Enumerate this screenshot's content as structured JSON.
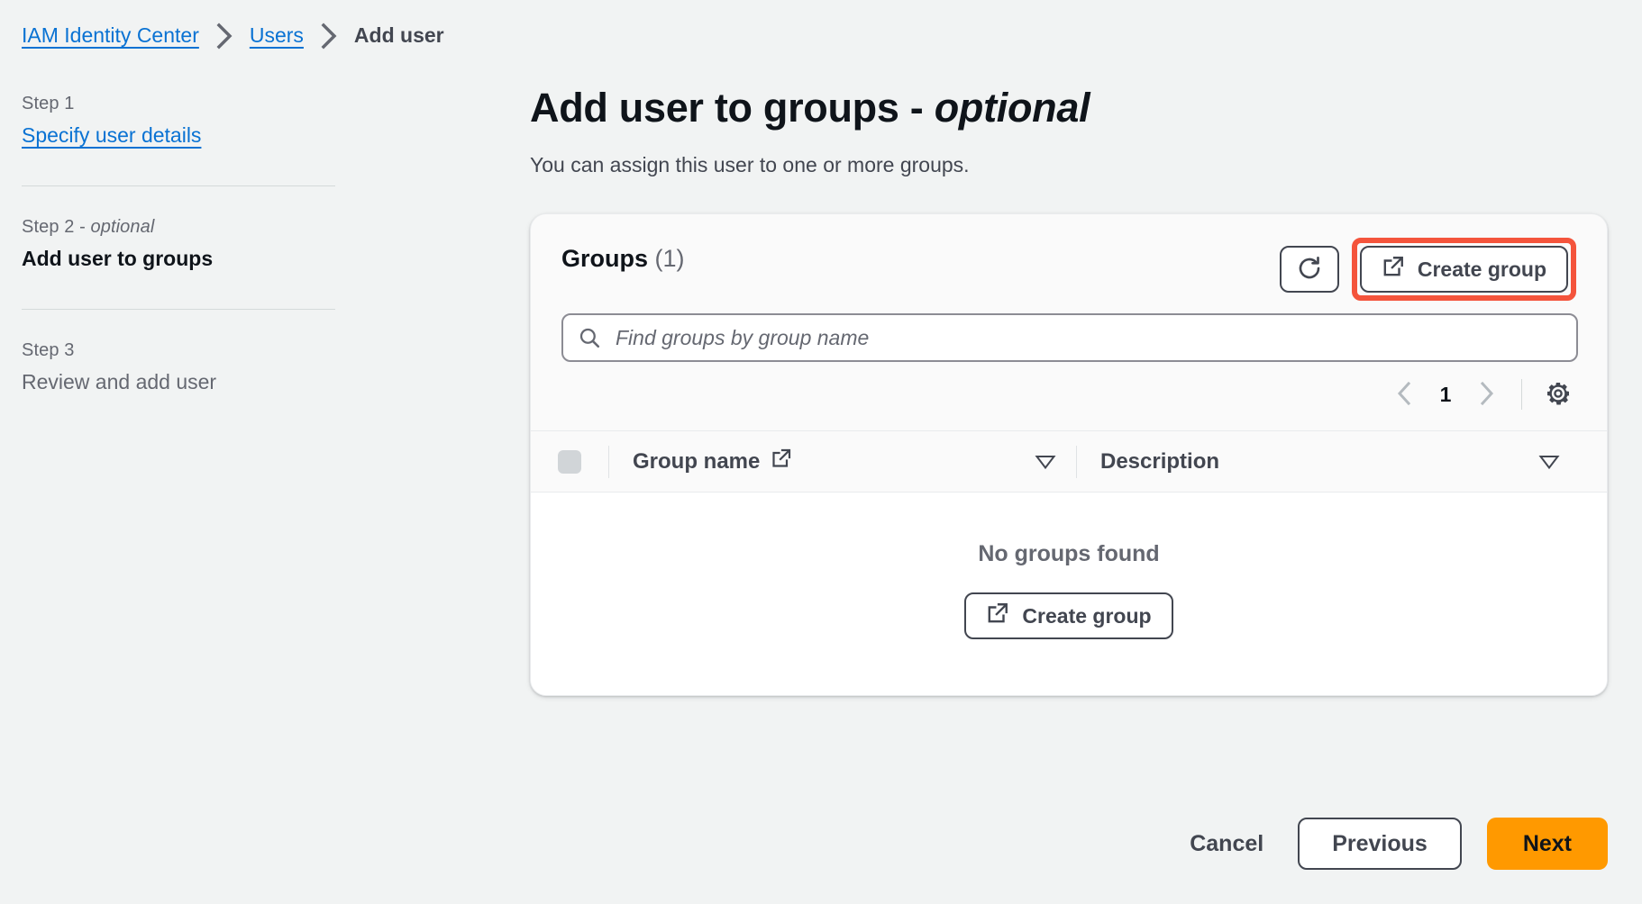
{
  "breadcrumb": {
    "items": [
      {
        "label": "IAM Identity Center",
        "type": "link"
      },
      {
        "label": "Users",
        "type": "link"
      },
      {
        "label": "Add user",
        "type": "current"
      }
    ],
    "separator_icon": "chevron-right-icon"
  },
  "sidebar": {
    "steps": [
      {
        "step_label": "Step 1",
        "optional_suffix": "",
        "title": "Specify user details",
        "state": "link"
      },
      {
        "step_label": "Step 2 - ",
        "optional_suffix": "optional",
        "title": "Add user to groups",
        "state": "active"
      },
      {
        "step_label": "Step 3",
        "optional_suffix": "",
        "title": "Review and add user",
        "state": "idle"
      }
    ]
  },
  "main": {
    "title": "Add user to groups - ",
    "title_optional": "optional",
    "description": "You can assign this user to one or more groups."
  },
  "panel": {
    "title": "Groups",
    "count": "(1)",
    "refresh_icon": "refresh-icon",
    "create_group_label": "Create group",
    "create_group_icon": "external-link-icon",
    "highlight_color": "#f4543c",
    "search": {
      "icon": "search-icon",
      "placeholder": "Find groups by group name",
      "value": ""
    },
    "pagination": {
      "previous_icon": "chevron-left-icon",
      "next_icon": "chevron-right-icon",
      "current_page": "1",
      "settings_icon": "gear-icon"
    },
    "table": {
      "select_all_icon": "checkbox-disabled-icon",
      "columns": [
        {
          "label": "Group name",
          "icon": "external-link-icon",
          "sort_icon": "sort-triangle-icon"
        },
        {
          "label": "Description",
          "icon": "",
          "sort_icon": "sort-triangle-icon"
        }
      ],
      "rows": [],
      "empty_text": "No groups found",
      "empty_action_label": "Create group",
      "empty_action_icon": "external-link-icon"
    }
  },
  "footer": {
    "cancel_label": "Cancel",
    "previous_label": "Previous",
    "next_label": "Next",
    "next_color": "#ff9900"
  }
}
